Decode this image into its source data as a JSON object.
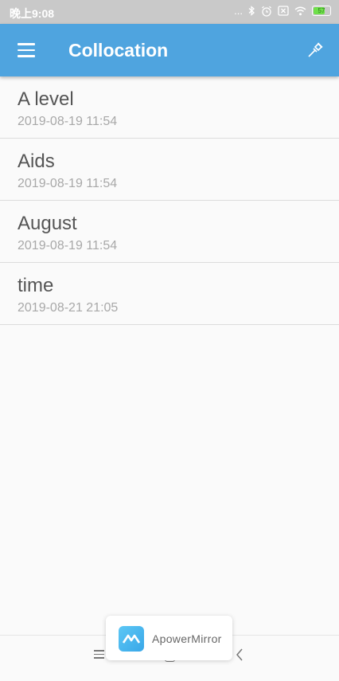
{
  "status_bar": {
    "time": "晚上9:08",
    "signal_dots": "...",
    "battery_level": "57"
  },
  "app_bar": {
    "title": "Collocation"
  },
  "items": [
    {
      "title": "A level",
      "date": "2019-08-19 11:54"
    },
    {
      "title": "Aids",
      "date": "2019-08-19 11:54"
    },
    {
      "title": "August",
      "date": "2019-08-19 11:54"
    },
    {
      "title": "time",
      "date": "2019-08-21 21:05"
    }
  ],
  "overlay": {
    "label": "ApowerMirror"
  },
  "colors": {
    "app_bar": "#4fa4df",
    "status_bar": "#c9c9c9",
    "background": "#fafafa"
  }
}
